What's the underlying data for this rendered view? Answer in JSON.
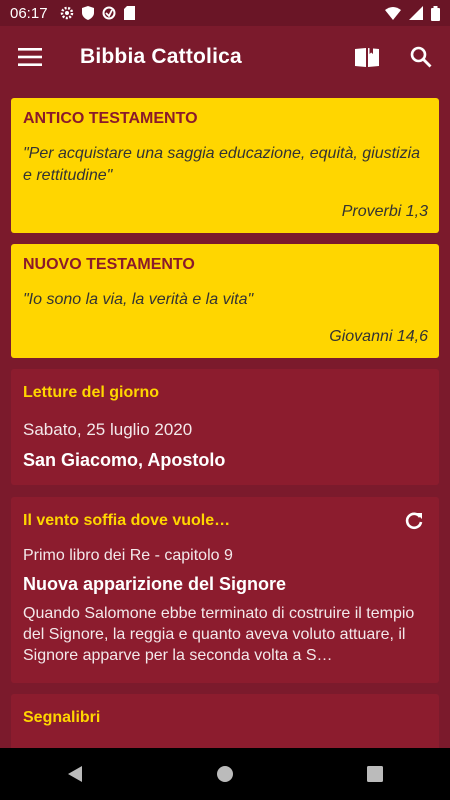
{
  "status": {
    "time": "06:17"
  },
  "appbar": {
    "title": "Bibbia Cattolica",
    "menu_icon": "menu-icon",
    "book_icon": "book-icon",
    "search_icon": "search-icon"
  },
  "cards": {
    "at": {
      "header": "ANTICO TESTAMENTO",
      "quote": "\"Per acquistare una saggia educazione, equità, giustizia e rettitudine\"",
      "reference": "Proverbi 1,3"
    },
    "nt": {
      "header": "NUOVO TESTAMENTO",
      "quote": "\"Io sono la via, la verità e la vita\"",
      "reference": "Giovanni 14,6"
    },
    "letture": {
      "header": "Letture del giorno",
      "date": "Sabato, 25 luglio 2020",
      "saint": "San Giacomo, Apostolo"
    },
    "vento": {
      "header": "Il vento soffia dove vuole…",
      "subtitle": "Primo libro dei Re - capitolo 9",
      "title": "Nuova apparizione del Signore",
      "excerpt": "Quando Salomone ebbe terminato di costruire il tempio del Signore, la reggia e quanto aveva voluto attuare, il Signore apparve per la seconda volta a S…"
    },
    "segnalibri": {
      "header": "Segnalibri"
    }
  },
  "colors": {
    "primary": "#7b1a2c",
    "card_dark": "#8c1c2e",
    "accent": "#ffd600"
  }
}
